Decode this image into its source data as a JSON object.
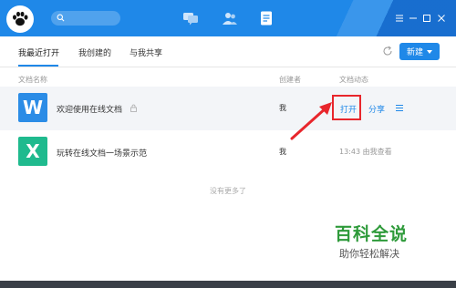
{
  "titlebar": {
    "colors": {
      "bar": "#1f88e8"
    },
    "tabs": [
      "chat-icon",
      "contacts-icon",
      "docs-icon"
    ],
    "controls": [
      "menu-icon",
      "minimize-icon",
      "maximize-icon",
      "close-icon"
    ]
  },
  "subtabs": {
    "items": [
      "我最近打开",
      "我创建的",
      "与我共享"
    ],
    "active": "我最近打开"
  },
  "toolbar": {
    "new_label": "新建"
  },
  "columns": {
    "name": "文档名称",
    "creator": "创建者",
    "activity": "文档动态"
  },
  "rows": [
    {
      "name": "欢迎使用在线文档",
      "creator": "我",
      "icon_letter": "W",
      "icon_color": "#2b8ce6",
      "open_label": "打开",
      "share_label": "分享",
      "locked": true
    },
    {
      "name": "玩转在线文档一场景示范",
      "creator": "我",
      "icon_letter": "X",
      "icon_color": "#1fba8e",
      "activity": "13:43 由我查看"
    }
  ],
  "empty_hint": "没有更多了",
  "watermark": {
    "title": "百科全说",
    "subtitle": "助你轻松解决"
  },
  "accent": "#e8262c"
}
